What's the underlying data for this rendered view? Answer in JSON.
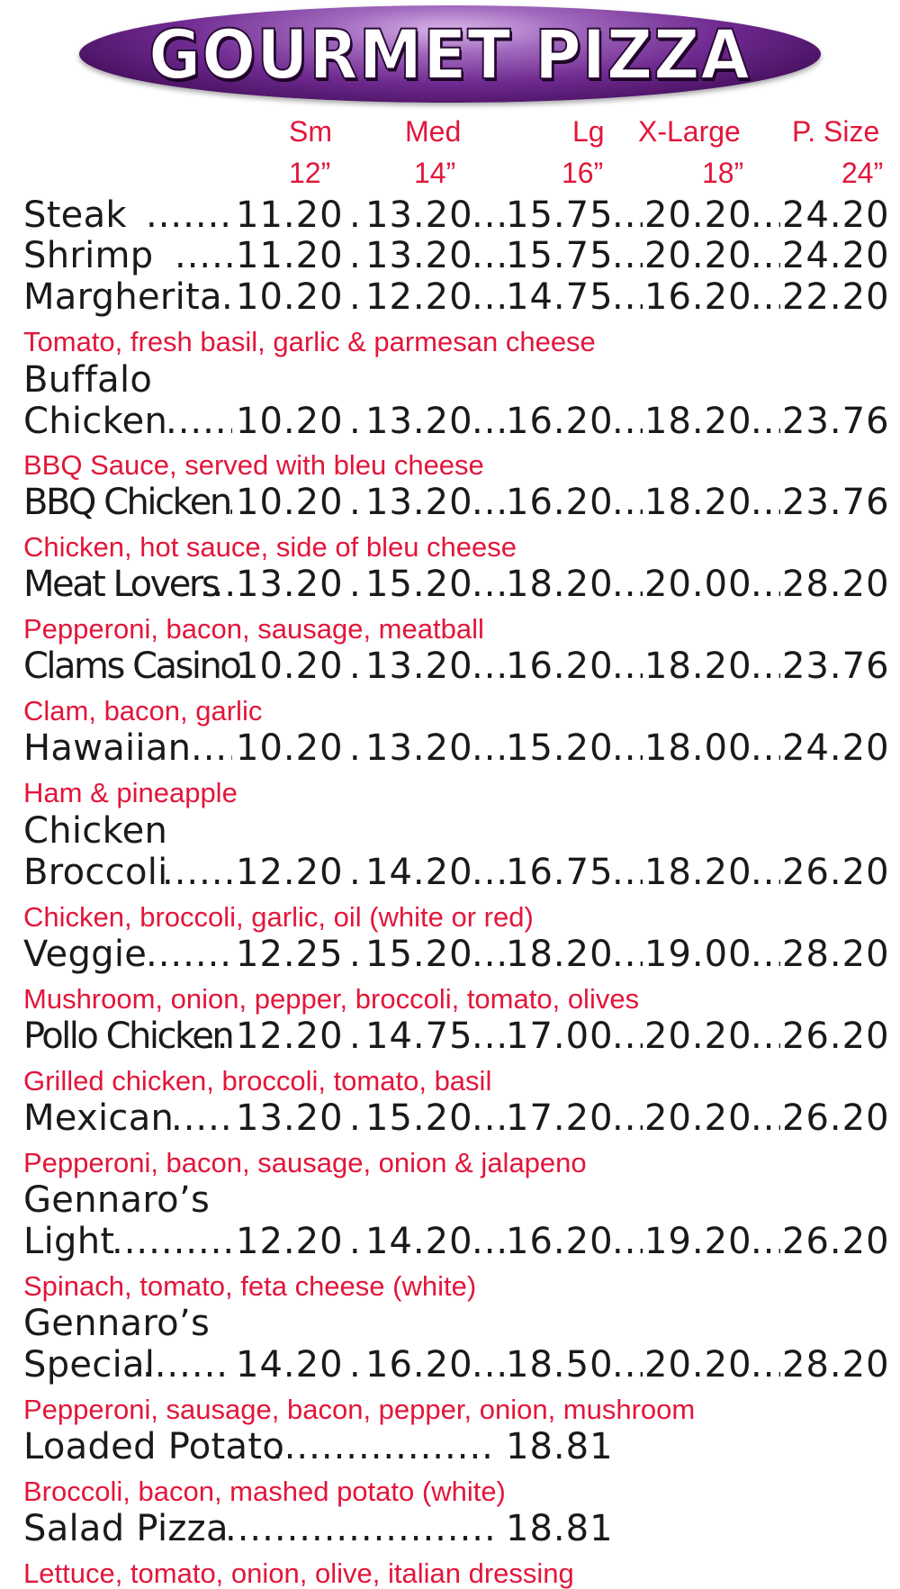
{
  "title": "GOURMET PIZZA",
  "sizes": [
    {
      "label": "Sm",
      "inches": "12”"
    },
    {
      "label": "Med",
      "inches": "14”"
    },
    {
      "label": "Lg",
      "inches": "16”"
    },
    {
      "label": "X-Large",
      "inches": "18”"
    },
    {
      "label": "P. Size",
      "inches": "24”"
    }
  ],
  "items": [
    {
      "name": "Steak",
      "prices": [
        "11.20",
        "13.20",
        "15.75",
        "20.20",
        "24.20"
      ]
    },
    {
      "name": "Shrimp",
      "prices": [
        "11.20",
        "13.20",
        "15.75",
        "20.20",
        "24.20"
      ]
    },
    {
      "name": "Margherita",
      "prices": [
        "10.20",
        "12.20",
        "14.75",
        "16.20",
        "22.20"
      ],
      "desc": "Tomato, fresh basil, garlic & parmesan cheese"
    },
    {
      "name_prefix": "Buffalo",
      "name": "Chicken",
      "prices": [
        "10.20",
        "13.20",
        "16.20",
        "18.20",
        "23.76"
      ],
      "desc": "BBQ Sauce, served with bleu cheese"
    },
    {
      "name": "BBQ Chicken",
      "prices": [
        "10.20",
        "13.20",
        "16.20",
        "18.20",
        "23.76"
      ],
      "desc": "Chicken, hot sauce, side of bleu cheese"
    },
    {
      "name": "Meat Lovers",
      "prices": [
        "13.20",
        "15.20",
        "18.20",
        "20.00",
        "28.20"
      ],
      "desc": "Pepperoni, bacon, sausage, meatball"
    },
    {
      "name": "Clams Casino",
      "prices": [
        "10.20",
        "13.20",
        "16.20",
        "18.20",
        "23.76"
      ],
      "desc": "Clam, bacon, garlic"
    },
    {
      "name": "Hawaiian",
      "prices": [
        "10.20",
        "13.20",
        "15.20",
        "18.00",
        "24.20"
      ],
      "desc": "Ham & pineapple"
    },
    {
      "name_prefix": "Chicken",
      "name": "Broccoli",
      "prices": [
        "12.20",
        "14.20",
        "16.75",
        "18.20",
        "26.20"
      ],
      "desc": "Chicken, broccoli, garlic, oil (white or red)"
    },
    {
      "name": "Veggie",
      "prices": [
        "12.25",
        "15.20",
        "18.20",
        "19.00",
        "28.20"
      ],
      "desc": "Mushroom, onion, pepper, broccoli, tomato, olives"
    },
    {
      "name": "Pollo Chicken",
      "prices": [
        "12.20",
        "14.75",
        "17.00",
        "20.20",
        "26.20"
      ],
      "desc": "Grilled chicken, broccoli, tomato, basil"
    },
    {
      "name": "Mexican",
      "prices": [
        "13.20",
        "15.20",
        "17.20",
        "20.20",
        "26.20"
      ],
      "desc": "Pepperoni, bacon, sausage, onion & jalapeno"
    },
    {
      "name_prefix": "Gennaro’s",
      "name": "Light",
      "prices": [
        "12.20",
        "14.20",
        "16.20",
        "19.20",
        "26.20"
      ],
      "desc": "Spinach, tomato, feta cheese (white)"
    },
    {
      "name_prefix": "Gennaro’s",
      "name": "Special",
      "prices": [
        "14.20",
        "16.20",
        "18.50",
        "20.20",
        "28.20"
      ],
      "desc": "Pepperoni, sausage, bacon, pepper, onion, mushroom"
    },
    {
      "name": "Loaded Potato",
      "price": "18.81",
      "desc": "Broccoli, bacon, mashed potato (white)"
    },
    {
      "name": "Salad Pizza",
      "price": "18.81",
      "desc": "Lettuce, tomato, onion, olive, italian dressing"
    }
  ]
}
